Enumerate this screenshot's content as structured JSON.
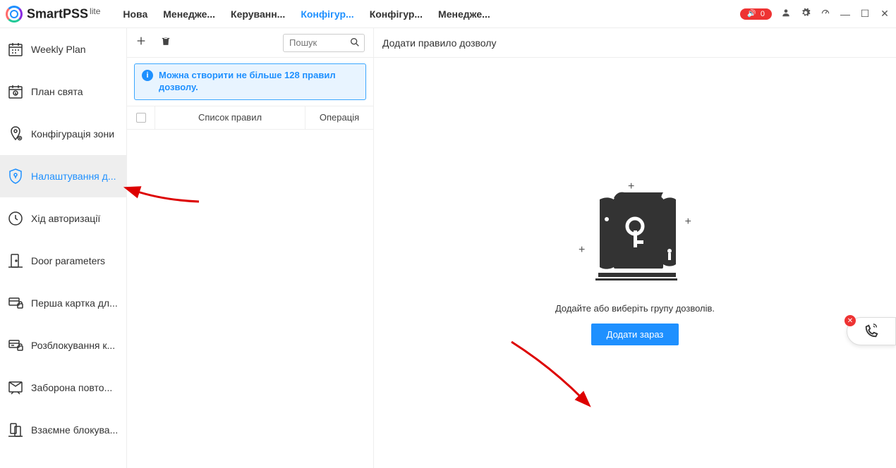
{
  "app": {
    "name": "SmartPSS",
    "lite": "lite"
  },
  "titlebar": {
    "tabs": [
      {
        "label": "Нова"
      },
      {
        "label": "Менедже..."
      },
      {
        "label": "Керуванн..."
      },
      {
        "label": "Конфігур..."
      },
      {
        "label": "Конфігур..."
      },
      {
        "label": "Менедже..."
      }
    ],
    "active_tab": 3,
    "badge": "0"
  },
  "sidebar": {
    "items": [
      {
        "label": "Weekly Plan"
      },
      {
        "label": "План свята"
      },
      {
        "label": "Конфігурація зони"
      },
      {
        "label": "Налаштування д..."
      },
      {
        "label": "Хід авторизації"
      },
      {
        "label": "Door parameters"
      },
      {
        "label": "Перша картка дл..."
      },
      {
        "label": "Розблокування к..."
      },
      {
        "label": "Заборона повто..."
      },
      {
        "label": "Взаємне блокува..."
      }
    ],
    "active": 3
  },
  "middle": {
    "search_placeholder": "Пошук",
    "info": "Можна створити не більше 128 правил дозволу.",
    "columns": {
      "rules": "Список правил",
      "operation": "Операція"
    }
  },
  "right": {
    "title": "Додати правило дозволу",
    "empty_text": "Додайте або виберіть групу дозволів.",
    "add_button": "Додати зараз"
  }
}
